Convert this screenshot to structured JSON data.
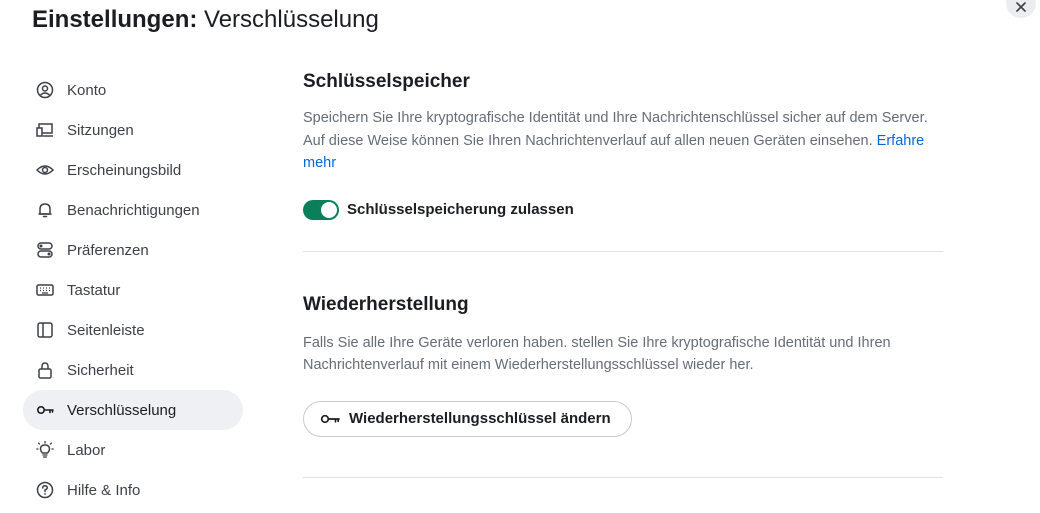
{
  "dialog": {
    "title_strong": "Einstellungen:",
    "title_rest": "Verschlüsselung"
  },
  "sidebar": {
    "items": [
      {
        "label": "Konto",
        "icon": "user-circle-icon"
      },
      {
        "label": "Sitzungen",
        "icon": "devices-icon"
      },
      {
        "label": "Erscheinungsbild",
        "icon": "eye-icon"
      },
      {
        "label": "Benachrichtigungen",
        "icon": "bell-icon"
      },
      {
        "label": "Präferenzen",
        "icon": "preferences-icon"
      },
      {
        "label": "Tastatur",
        "icon": "keyboard-icon"
      },
      {
        "label": "Seitenleiste",
        "icon": "sidebar-icon"
      },
      {
        "label": "Sicherheit",
        "icon": "lock-icon"
      },
      {
        "label": "Verschlüsselung",
        "icon": "key-icon",
        "active": true
      },
      {
        "label": "Labor",
        "icon": "lightbulb-icon"
      },
      {
        "label": "Hilfe & Info",
        "icon": "help-circle-icon"
      }
    ]
  },
  "key_storage": {
    "title": "Schlüsselspeicher",
    "description": "Speichern Sie Ihre kryptografische Identität und Ihre Nachrichtenschlüssel sicher auf dem Server. Auf diese Weise können Sie Ihren Nachrichtenverlauf auf allen neuen Geräten einsehen.",
    "learn_more": "Erfahre mehr",
    "toggle_label": "Schlüsselspeicherung zulassen",
    "toggle_on": true
  },
  "recovery": {
    "title": "Wiederherstellung",
    "description": "Falls Sie alle Ihre Geräte verloren haben. stellen Sie Ihre kryptografische Identität und Ihren Nachrichtenverlauf mit einem Wiederherstellungsschlüssel wieder her.",
    "button_label": "Wiederherstellungsschlüssel ändern"
  },
  "colors": {
    "accent_green": "#0b7f59",
    "link_blue": "#0467dd",
    "active_bg": "#eef0f3"
  }
}
